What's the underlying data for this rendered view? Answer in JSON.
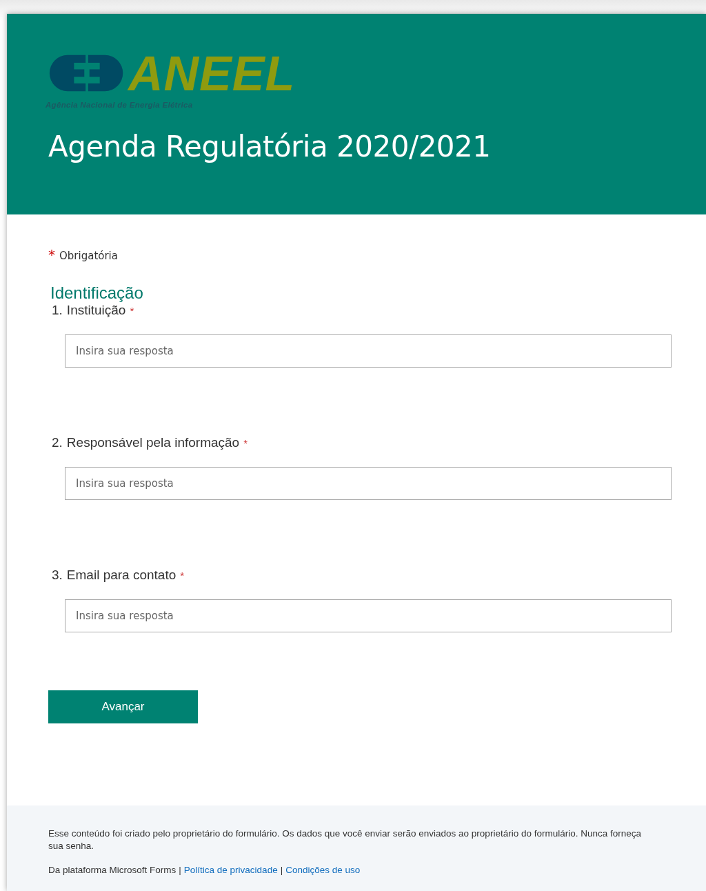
{
  "header": {
    "logo": {
      "wordmark": "ANEEL",
      "subtitle": "Agência Nacional de Energia Elétrica"
    },
    "title": "Agenda Regulatória 2020/2021"
  },
  "required_note": {
    "mark": "*",
    "text": "Obrigatória"
  },
  "section_title": "Identificação",
  "questions": [
    {
      "number": "1.",
      "label": "Instituição",
      "required": true,
      "placeholder": "Insira sua resposta"
    },
    {
      "number": "2.",
      "label": "Responsável pela informação",
      "required": true,
      "placeholder": "Insira sua resposta"
    },
    {
      "number": "3.",
      "label": "Email para contato",
      "required": true,
      "placeholder": "Insira sua resposta"
    }
  ],
  "next_button": "Avançar",
  "footer": {
    "notice": "Esse conteúdo foi criado pelo proprietário do formulário. Os dados que você enviar serão enviados ao proprietário do formulário. Nunca forneça sua senha.",
    "platform": "Da plataforma Microsoft Forms",
    "separator": "|",
    "links": [
      "Política de privacidade",
      "Condições de uso"
    ]
  }
}
